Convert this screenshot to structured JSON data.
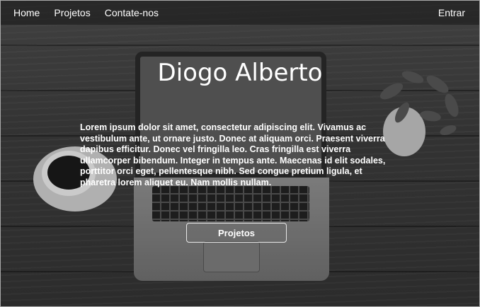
{
  "nav": {
    "home": "Home",
    "projects": "Projetos",
    "contact": "Contate-nos",
    "login": "Entrar"
  },
  "hero": {
    "title": "Diogo Alberto",
    "description": "Lorem ipsum dolor sit amet, consectetur adipiscing elit. Vivamus ac vestibulum ante, ut ornare justo. Donec at aliquam orci. Praesent viverra dapibus efficitur. Donec vel fringilla leo. Cras fringilla est viverra ullamcorper bibendum. Integer in tempus ante. Maecenas id elit sodales, porttitor orci eget, pellentesque nibh. Sed congue pretium ligula, et pharetra lorem aliquet eu. Nam mollis nullam.",
    "cta_label": "Projetos"
  },
  "colors": {
    "text": "#ffffff",
    "navbar_bg": "#141414"
  }
}
